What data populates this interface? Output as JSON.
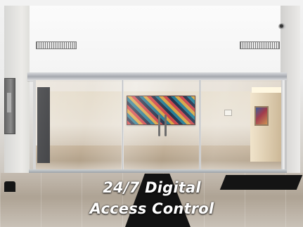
{
  "caption": {
    "line1": "24/7 Digital",
    "line2": "Access Control"
  }
}
